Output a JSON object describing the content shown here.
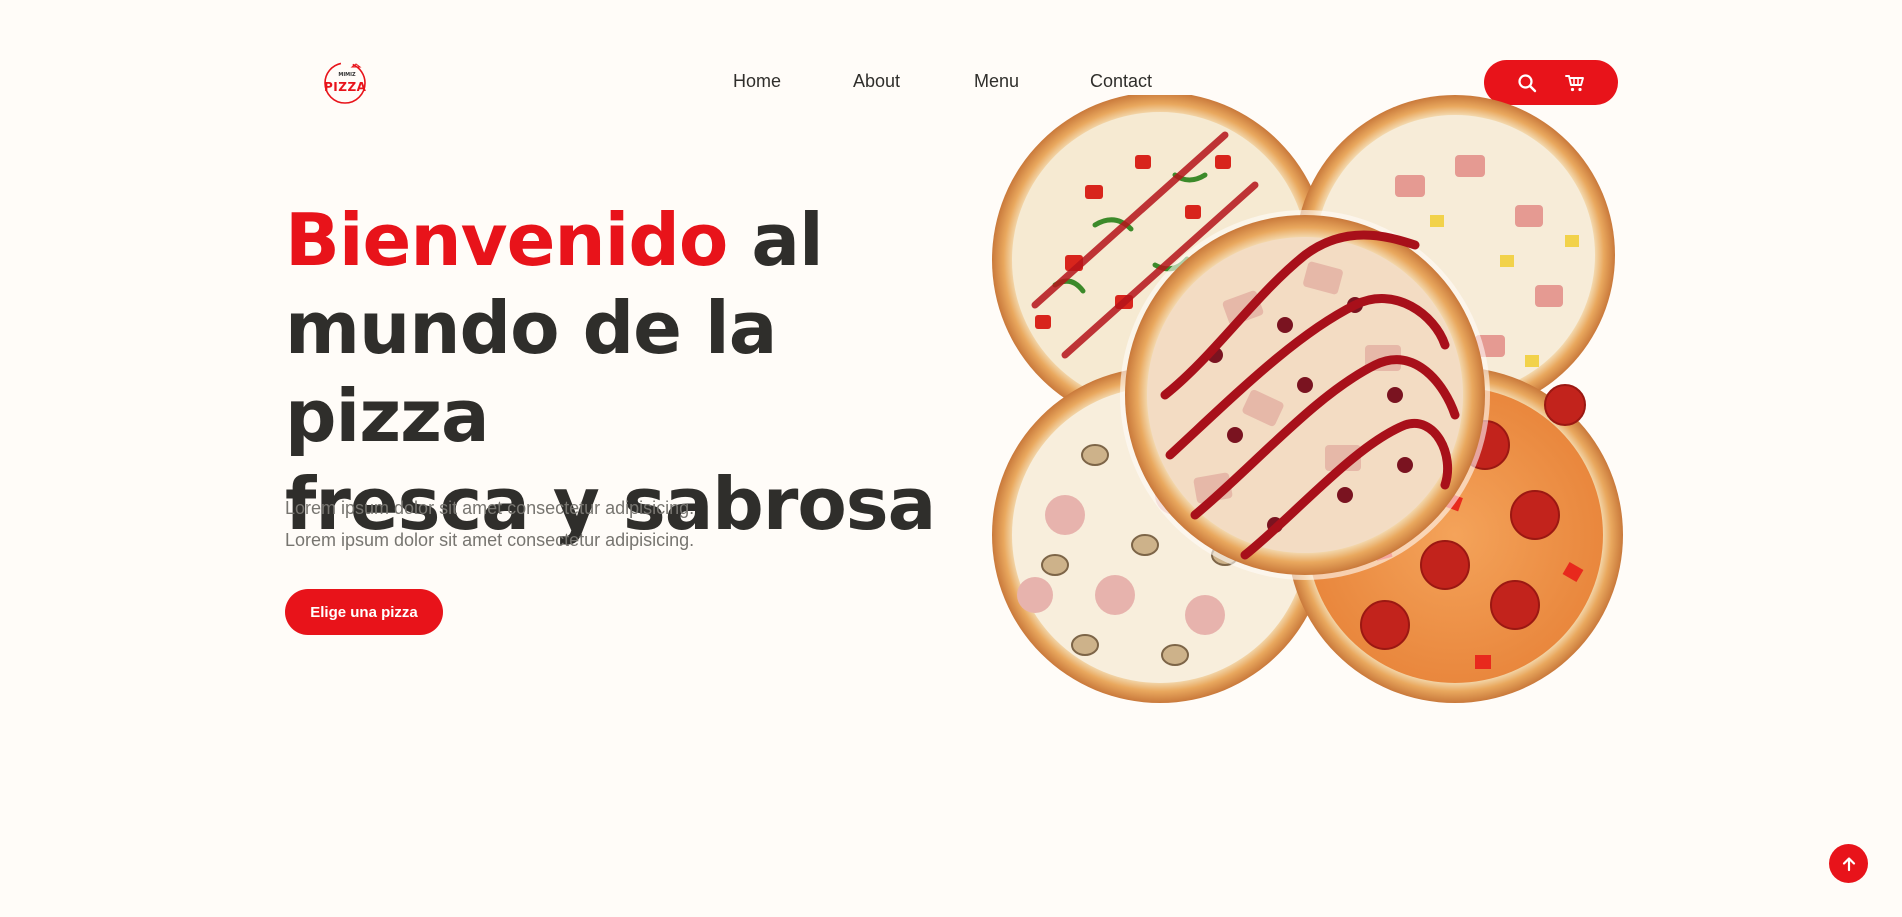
{
  "header": {
    "logo": {
      "brand_top": "MIMIZ",
      "brand_main": "PIZZA",
      "icon": "pizza-logo-icon"
    },
    "nav": [
      {
        "label": "Home"
      },
      {
        "label": "About"
      },
      {
        "label": "Menu"
      },
      {
        "label": "Contact"
      }
    ],
    "actions": {
      "search_icon": "search-icon",
      "cart_icon": "cart-icon"
    }
  },
  "hero": {
    "title_accent": "Bienvenido",
    "title_rest_1": " al",
    "title_line_2": "mundo de la pizza",
    "title_line_3": "fresca y sabrosa",
    "desc_line_1": "Lorem ipsum dolor sit amet consectetur adipisicing.",
    "desc_line_2": "Lorem ipsum dolor sit amet consectetur adipisicing.",
    "cta_label": "Elige una pizza"
  },
  "scroll_top_icon": "arrow-up-icon",
  "colors": {
    "accent": "#e8131a",
    "text": "#2f2e2b",
    "muted": "#777570",
    "background": "#fffcf8"
  }
}
